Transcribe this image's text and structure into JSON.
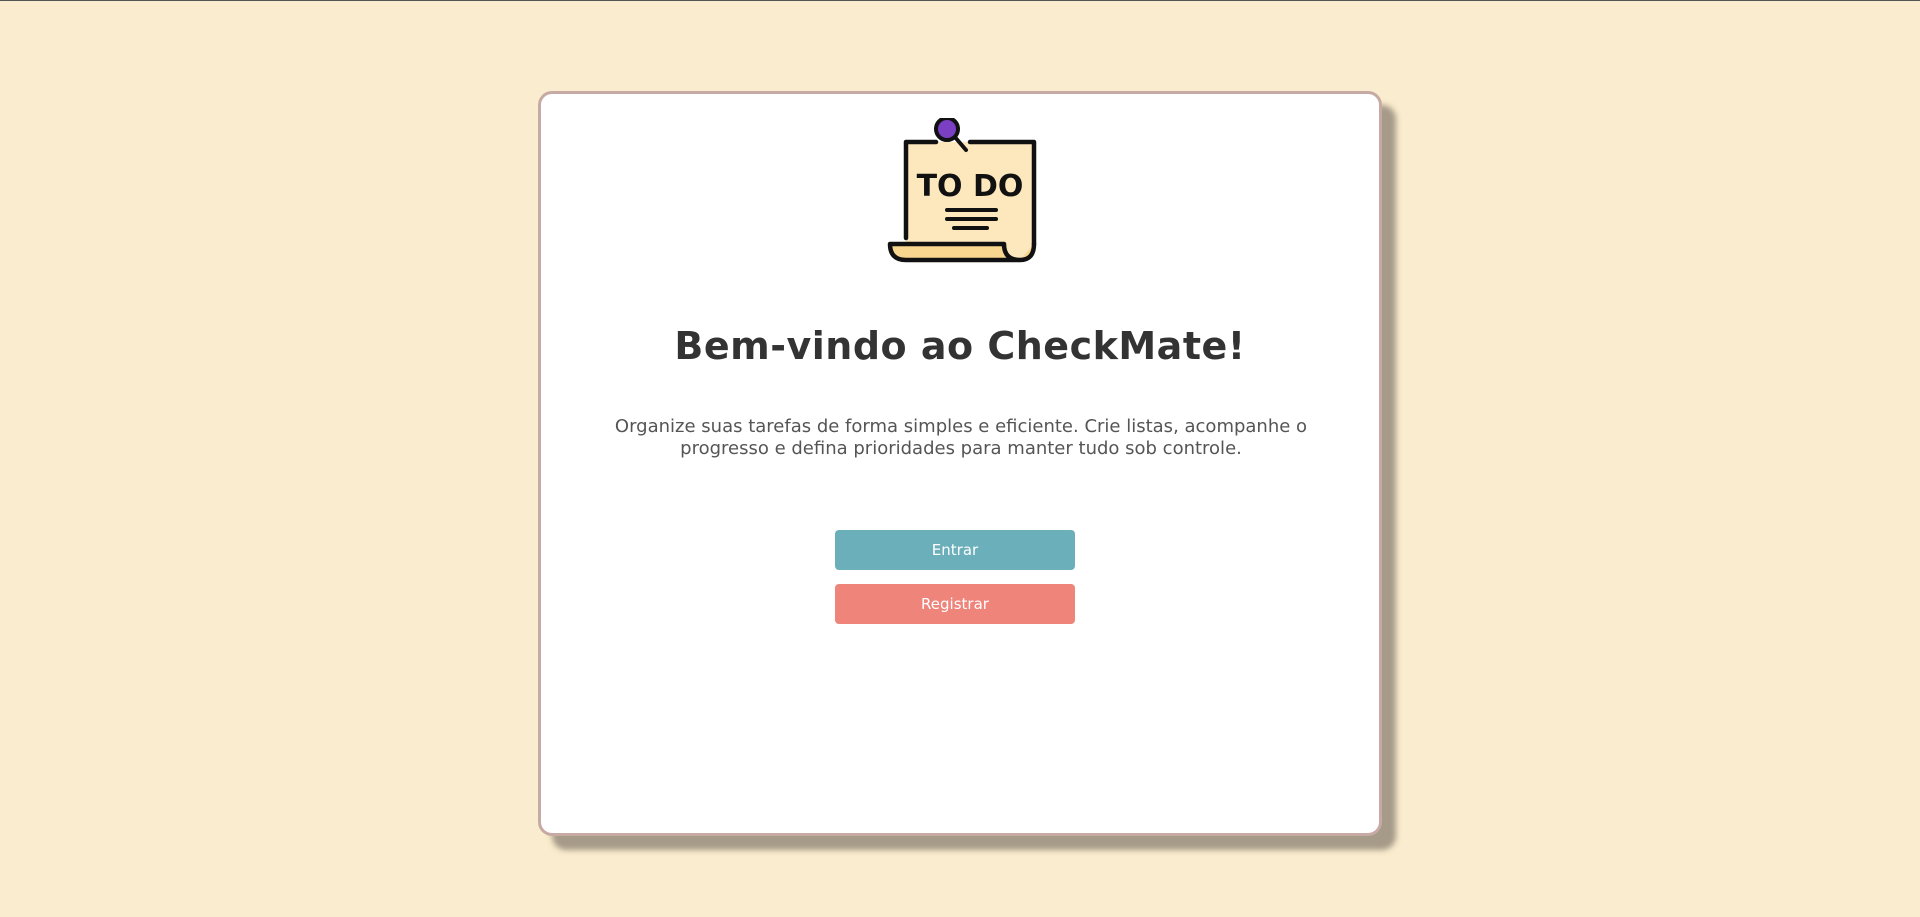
{
  "welcome": {
    "title": "Bem-vindo ao CheckMate!",
    "description": "Organize suas tarefas de forma simples e eficiente. Crie listas, acompanhe o progresso e defina prioridades para manter tudo sob controle."
  },
  "logo": {
    "icon": "todo-note-icon",
    "text": "TO DO"
  },
  "actions": {
    "login_label": "Entrar",
    "register_label": "Registrar"
  },
  "colors": {
    "background": "#faecce",
    "card": "#ffffff",
    "card_border": "#c8aaa5",
    "login_button": "#6aafba",
    "register_button": "#ee847a",
    "pin": "#7b3fc4",
    "note": "#fde8bd"
  }
}
